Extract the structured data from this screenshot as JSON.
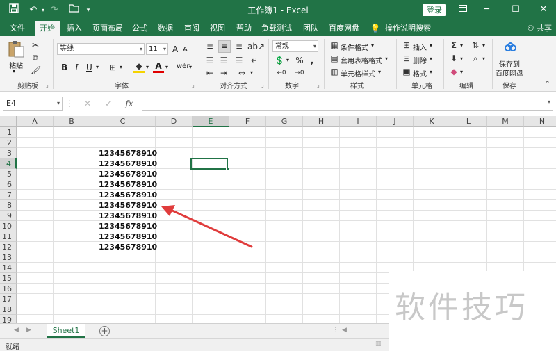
{
  "window": {
    "title": "工作簿1 - Excel",
    "login_label": "登录",
    "quick_access": [
      "save-icon",
      "undo-icon",
      "redo-icon",
      "open-icon",
      "customize-icon"
    ]
  },
  "ribbon_tabs": [
    {
      "label": "文件"
    },
    {
      "label": "开始",
      "active": true
    },
    {
      "label": "插入"
    },
    {
      "label": "页面布局"
    },
    {
      "label": "公式"
    },
    {
      "label": "数据"
    },
    {
      "label": "审阅"
    },
    {
      "label": "视图"
    },
    {
      "label": "帮助"
    },
    {
      "label": "负载测试"
    },
    {
      "label": "团队"
    },
    {
      "label": "百度网盘"
    },
    {
      "label": "操作说明搜索"
    }
  ],
  "share_label": "共享",
  "clipboard": {
    "paste_label": "粘贴",
    "group_label": "剪贴板"
  },
  "font": {
    "name": "等线",
    "size": "11",
    "bold": "B",
    "italic": "I",
    "underline": "U",
    "grow": "A",
    "shrink": "A",
    "phonetic": "wén",
    "group_label": "字体"
  },
  "alignment": {
    "group_label": "对齐方式"
  },
  "number": {
    "format": "常规",
    "group_label": "数字"
  },
  "styles": {
    "conditional": "条件格式",
    "table": "套用表格格式",
    "cell": "单元格样式",
    "group_label": "样式"
  },
  "cells": {
    "insert": "插入",
    "delete": "删除",
    "format": "格式",
    "group_label": "单元格"
  },
  "editing": {
    "group_label": "编辑"
  },
  "save": {
    "line1": "保存到",
    "line2": "百度网盘",
    "group_label": "保存"
  },
  "formula_bar": {
    "name_box": "E4",
    "fx": "fx",
    "value": ""
  },
  "grid": {
    "columns": [
      "A",
      "B",
      "C",
      "D",
      "E",
      "F",
      "G",
      "H",
      "I",
      "J",
      "K",
      "L",
      "M",
      "N"
    ],
    "rows": [
      "1",
      "2",
      "3",
      "4",
      "5",
      "6",
      "7",
      "8",
      "9",
      "10",
      "11",
      "12",
      "13",
      "14",
      "15",
      "16",
      "17",
      "18",
      "19"
    ],
    "selected_column": "E",
    "selected_row": "4",
    "cells_C": [
      "",
      "",
      "12345678910",
      "12345678910",
      "12345678910",
      "12345678910",
      "12345678910",
      "12345678910",
      "12345678910",
      "12345678910",
      "12345678910",
      "12345678910"
    ]
  },
  "sheet_tab": "Sheet1",
  "status": "就绪",
  "watermark": "软件技巧",
  "colors": {
    "accent": "#217346",
    "arrow": "#e03c3c"
  }
}
